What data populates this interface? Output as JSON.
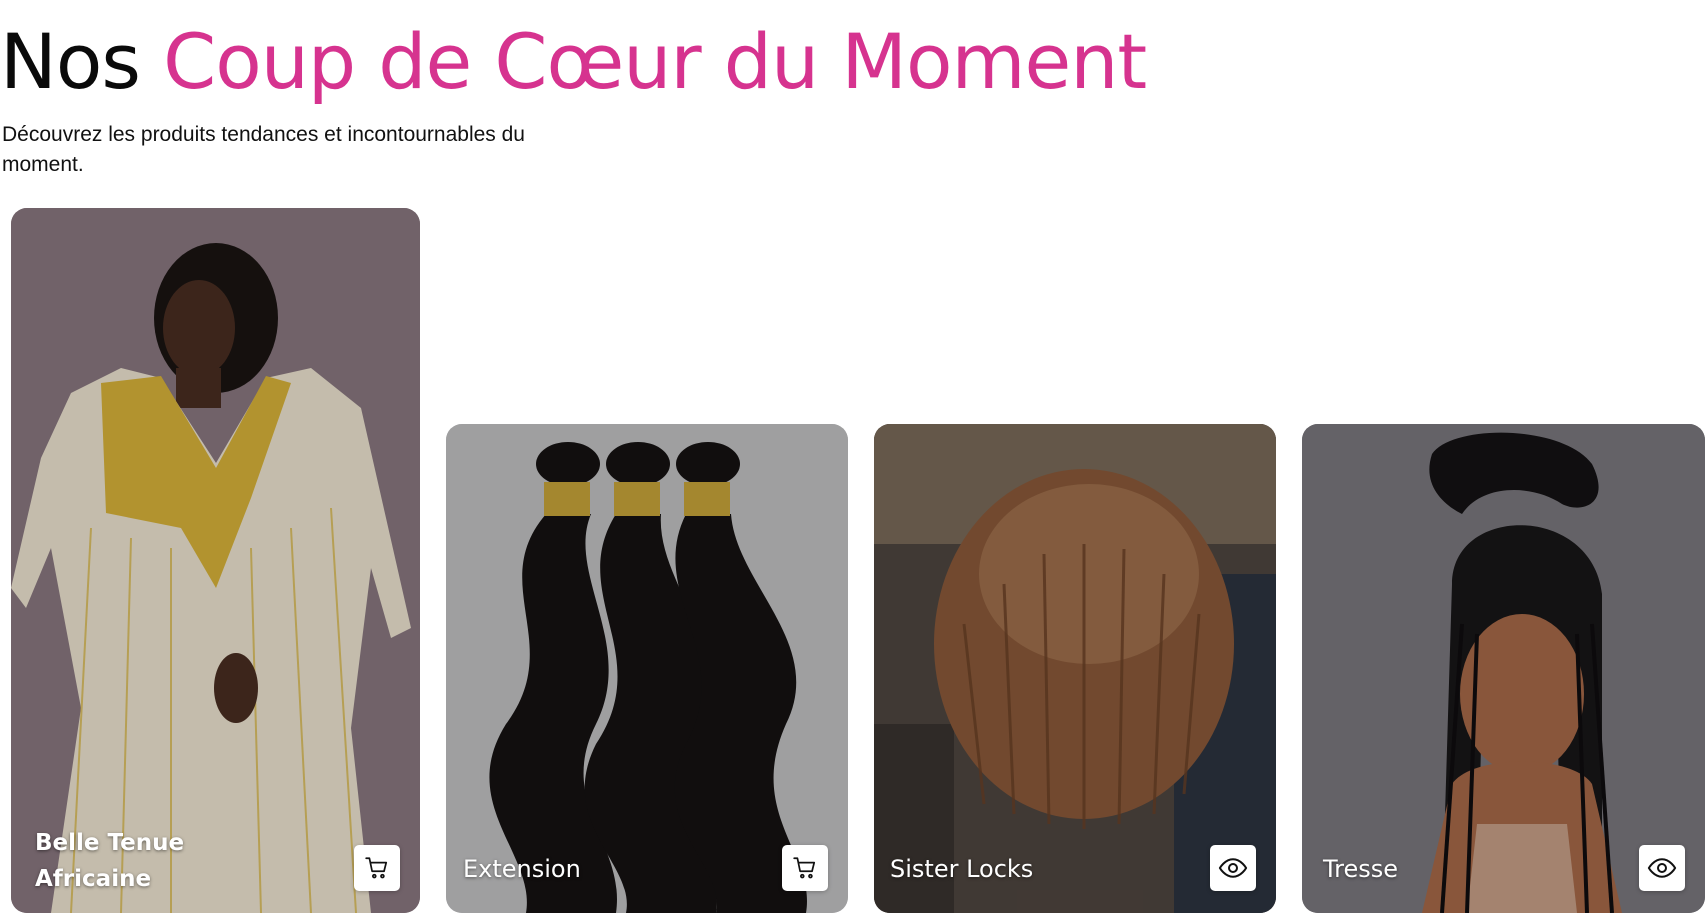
{
  "header": {
    "title_prefix": "Nos",
    "title_accent": "Coup de Cœur du Moment",
    "subtitle": "Découvrez les produits tendances et incontournables du moment."
  },
  "colors": {
    "accent": "#d6338f",
    "title": "#0a0a0a",
    "card_action_bg": "#ffffff"
  },
  "products": [
    {
      "name": "Belle Tenue Africaine",
      "action_icon": "cart-icon"
    },
    {
      "name": "Extension",
      "action_icon": "cart-icon"
    },
    {
      "name": "Sister Locks",
      "action_icon": "eye-icon"
    },
    {
      "name": "Tresse",
      "action_icon": "eye-icon"
    }
  ]
}
